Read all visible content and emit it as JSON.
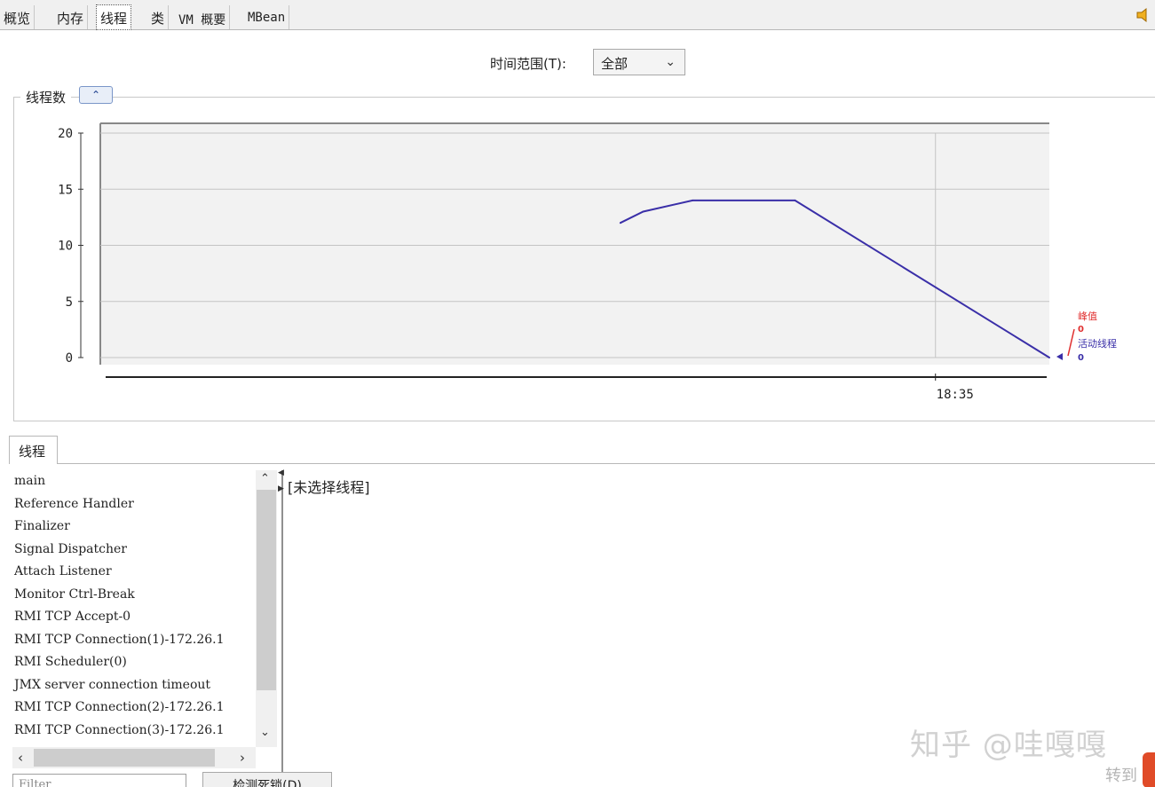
{
  "tabs": [
    {
      "label": "概览"
    },
    {
      "label": "内存"
    },
    {
      "label": "线程",
      "active": true
    },
    {
      "label": "类"
    },
    {
      "label": "VM 概要"
    },
    {
      "label": "MBean"
    }
  ],
  "time_range": {
    "label": "时间范围(T):",
    "value": "全部"
  },
  "thread_panel": {
    "title": "线程数"
  },
  "colors": {
    "peak": "#e03030",
    "live": "#3a2fa8",
    "accent": "#1a3c8c"
  },
  "chart_data": {
    "type": "line",
    "ylim": [
      0,
      20
    ],
    "yticks": [
      0,
      5,
      10,
      15,
      20
    ],
    "xticks": [
      "18:35"
    ],
    "series": [
      {
        "name": "峰值",
        "color": "#e03030",
        "current_value": "0",
        "points": []
      },
      {
        "name": "活动线程",
        "color": "#3a2fa8",
        "current_value": "0",
        "points": [
          [
            "18:33:37",
            12
          ],
          [
            "18:33:43",
            13
          ],
          [
            "18:33:56",
            14
          ],
          [
            "18:34:23",
            14
          ],
          [
            "18:35:30",
            0
          ]
        ]
      }
    ]
  },
  "lower": {
    "tab_label": "线程",
    "threads": [
      "main",
      "Reference Handler",
      "Finalizer",
      "Signal Dispatcher",
      "Attach Listener",
      "Monitor Ctrl-Break",
      "RMI TCP Accept-0",
      "RMI TCP Connection(1)-172.26.1",
      "RMI Scheduler(0)",
      "JMX server connection timeout",
      "RMI TCP Connection(2)-172.26.1",
      "RMI TCP Connection(3)-172.26.1"
    ],
    "detail_text": "[未选择线程]",
    "filter_placeholder": "Filter",
    "deadlock_button": "检测死锁(D)"
  },
  "watermark": "知乎 @哇嘎嘎",
  "activate_text": "转到"
}
